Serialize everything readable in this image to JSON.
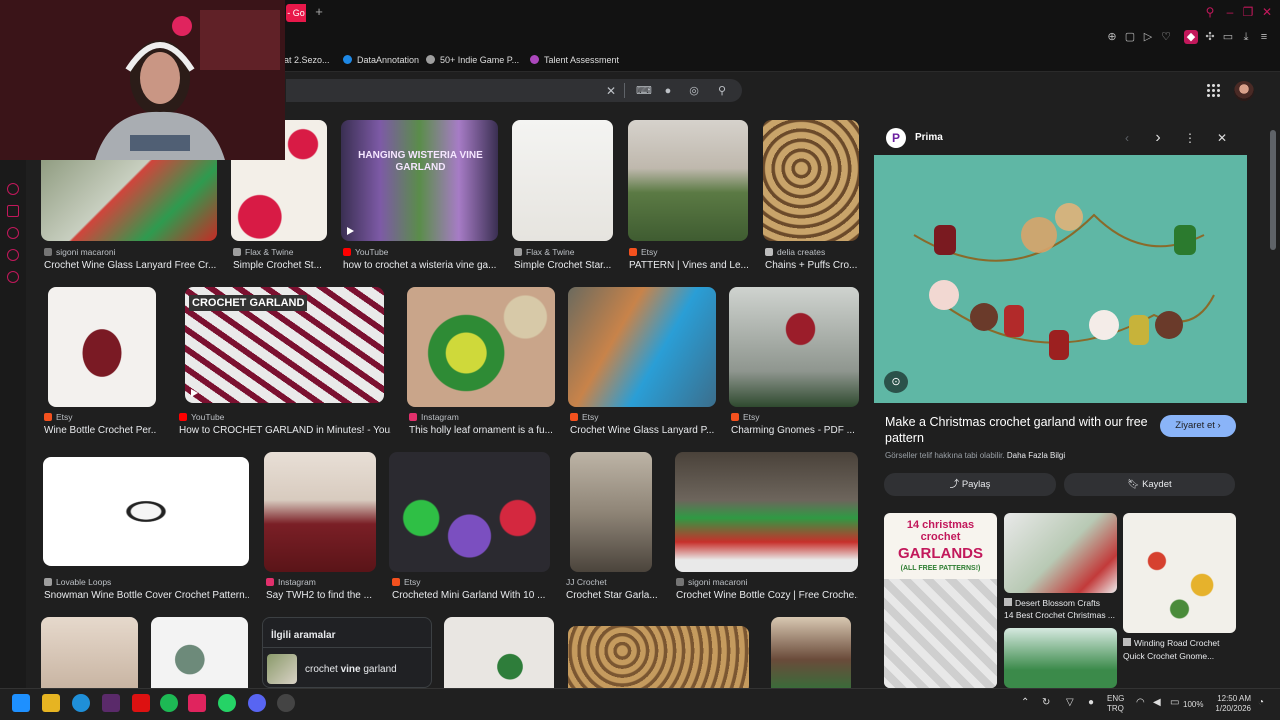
{
  "browser": {
    "active_tab_label": "- Go",
    "new_tab": "+",
    "bookmarks": [
      {
        "label": "at 2.Sezo...",
        "color": "#c2185b"
      },
      {
        "label": "DataAnnotation",
        "color": "#1e88e5"
      },
      {
        "label": "50+ Indie Game P...",
        "color": "#9e9e9e"
      },
      {
        "label": "Talent Assessment",
        "color": "#ab47bc"
      }
    ]
  },
  "search": {
    "query": ""
  },
  "results": [
    {
      "source": "sigoni macaroni",
      "caption": "Crochet Wine Glass Lanyard Free Cr...",
      "src_color": "#757575"
    },
    {
      "source": "Flax & Twine",
      "caption": "Simple Crochet St...",
      "src_color": "#9e9e9e"
    },
    {
      "source": "YouTube",
      "caption": "how to crochet a wisteria vine ga...",
      "src_color": "#ff0000",
      "overlay": "HANGING WISTERIA VINE GARLAND"
    },
    {
      "source": "Flax & Twine",
      "caption": "Simple Crochet Star...",
      "src_color": "#9e9e9e"
    },
    {
      "source": "Etsy",
      "caption": "PATTERN | Vines and Le...",
      "src_color": "#f4511e"
    },
    {
      "source": "delia creates",
      "caption": "Chains + Puffs Cro...",
      "src_color": "#bdbdbd"
    },
    {
      "source": "Etsy",
      "caption": "Wine Bottle Crochet Per...",
      "src_color": "#f4511e"
    },
    {
      "source": "YouTube",
      "caption": "How to CROCHET GARLAND in Minutes! - You...",
      "src_color": "#ff0000",
      "overlay": "CROCHET GARLAND"
    },
    {
      "source": "Instagram",
      "caption": "This holly leaf ornament is a fu...",
      "src_color": "#e1306c"
    },
    {
      "source": "Etsy",
      "caption": "Crochet Wine Glass Lanyard P...",
      "src_color": "#f4511e"
    },
    {
      "source": "Etsy",
      "caption": "Charming Gnomes - PDF ...",
      "src_color": "#f4511e"
    },
    {
      "source": "Lovable Loops",
      "caption": "Snowman Wine Bottle Cover Crochet Pattern...",
      "src_color": "#9e9e9e"
    },
    {
      "source": "Instagram",
      "caption": "Say TWH2 to find the ...",
      "src_color": "#e1306c"
    },
    {
      "source": "Etsy",
      "caption": "Crocheted Mini Garland With 10 ...",
      "src_color": "#f4511e"
    },
    {
      "source": "JJ Crochet",
      "caption": "Crochet Star Garla...",
      "src_color": "#9e9e9e"
    },
    {
      "source": "sigoni macaroni",
      "caption": "Crochet Wine Bottle Cozy | Free Croche...",
      "src_color": "#757575"
    }
  ],
  "related": {
    "title": "İlgili aramalar",
    "item_prefix": "crochet ",
    "item_bold": "vine",
    "item_suffix": " garland"
  },
  "panel": {
    "logo_letter": "P",
    "site": "Prima",
    "title": "Make a Christmas crochet garland with our free pattern",
    "visit_label": "Ziyaret et",
    "rights_text": "Görseller telif hakkına tabi olabilir.",
    "rights_link": "Daha Fazla Bilgi",
    "share_label": "Paylaş",
    "save_label": "Kaydet",
    "related_thumb_text_1": "14 christmas crochet",
    "related_thumb_text_2": "GARLANDS",
    "related_thumb_text_3": "(ALL FREE PATTERNS!)",
    "related_items": [
      {
        "source": "Desert Blossom Crafts",
        "caption": "14 Best Crochet Christmas ..."
      },
      {
        "source": "Winding Road Crochet",
        "caption": "Quick Crochet Gnome..."
      }
    ]
  },
  "taskbar": {
    "lang_1": "ENG",
    "lang_2": "TRQ",
    "battery": "100%",
    "time": "12:50 AM",
    "date": "1/20/2026"
  },
  "colors": {
    "accent": "#e8184a",
    "visit_button": "#8ab4f8"
  }
}
